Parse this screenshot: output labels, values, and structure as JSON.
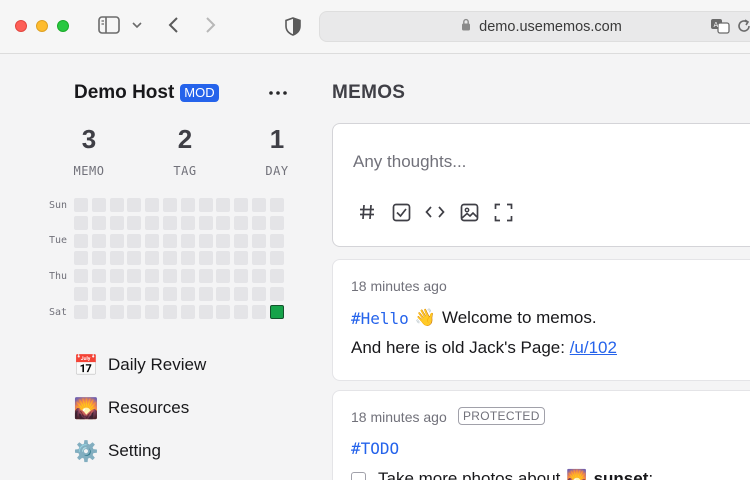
{
  "browser": {
    "url": "demo.usememos.com"
  },
  "sidebar": {
    "host_name": "Demo Host",
    "role_badge": "MOD",
    "more_label": "···",
    "stats": [
      {
        "value": "3",
        "label": "MEMO"
      },
      {
        "value": "2",
        "label": "TAG"
      },
      {
        "value": "1",
        "label": "DAY"
      }
    ],
    "weekdays": [
      "Sun",
      "Tue",
      "Thu",
      "Sat"
    ],
    "nav": [
      {
        "icon": "calendar-icon",
        "glyph": "📅",
        "label": "Daily Review"
      },
      {
        "icon": "picture-icon",
        "glyph": "🌄",
        "label": "Resources"
      },
      {
        "icon": "gear-icon",
        "glyph": "⚙️",
        "label": "Setting"
      }
    ]
  },
  "main": {
    "section_title": "MEMOS",
    "editor": {
      "placeholder": "Any thoughts..."
    },
    "memos": [
      {
        "time": "18 minutes ago",
        "tag": "#Hello",
        "emoji": "👋",
        "text1": "Welcome to memos.",
        "text2_prefix": "And here is old Jack's Page: ",
        "link": "/u/102"
      },
      {
        "time": "18 minutes ago",
        "visibility": "PROTECTED",
        "tag": "#TODO",
        "task_prefix": "Take more photos about",
        "task_emoji": "🌄",
        "task_bold": "sunset",
        "task_suffix": ";"
      }
    ]
  },
  "colors": {
    "accent": "#2563eb",
    "heat_active": "#16a34a"
  }
}
